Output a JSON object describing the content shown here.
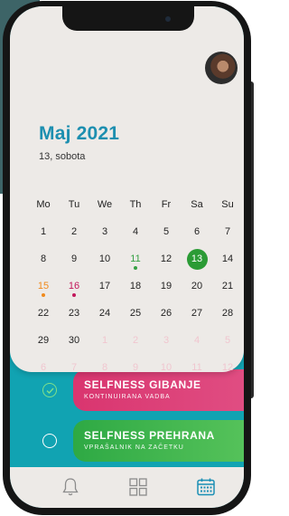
{
  "calendar": {
    "month_title": "Maj 2021",
    "date_subtitle": "13, sobota",
    "weekdays": [
      "Mo",
      "Tu",
      "We",
      "Th",
      "Fr",
      "Sa",
      "Su"
    ],
    "rows": [
      [
        {
          "d": "1"
        },
        {
          "d": "2"
        },
        {
          "d": "3"
        },
        {
          "d": "4"
        },
        {
          "d": "5"
        },
        {
          "d": "6"
        },
        {
          "d": "7"
        }
      ],
      [
        {
          "d": "8"
        },
        {
          "d": "9"
        },
        {
          "d": "10"
        },
        {
          "d": "11",
          "style": "green-txt",
          "dot": "green"
        },
        {
          "d": "12"
        },
        {
          "d": "13",
          "style": "selected"
        },
        {
          "d": "14"
        }
      ],
      [
        {
          "d": "15",
          "style": "orange-txt",
          "dot": "orange"
        },
        {
          "d": "16",
          "style": "pink-txt",
          "dot": "pink"
        },
        {
          "d": "17"
        },
        {
          "d": "18"
        },
        {
          "d": "19"
        },
        {
          "d": "20"
        },
        {
          "d": "21"
        }
      ],
      [
        {
          "d": "22"
        },
        {
          "d": "23"
        },
        {
          "d": "24"
        },
        {
          "d": "25"
        },
        {
          "d": "26"
        },
        {
          "d": "27"
        },
        {
          "d": "28"
        }
      ],
      [
        {
          "d": "29"
        },
        {
          "d": "30"
        },
        {
          "d": "1",
          "style": "muted"
        },
        {
          "d": "2",
          "style": "muted"
        },
        {
          "d": "3",
          "style": "muted"
        },
        {
          "d": "4",
          "style": "muted"
        },
        {
          "d": "5",
          "style": "muted"
        }
      ],
      [
        {
          "d": "6",
          "style": "muted"
        },
        {
          "d": "7",
          "style": "muted"
        },
        {
          "d": "8",
          "style": "muted"
        },
        {
          "d": "9",
          "style": "muted"
        },
        {
          "d": "10",
          "style": "muted"
        },
        {
          "d": "11",
          "style": "muted"
        },
        {
          "d": "12",
          "style": "muted"
        }
      ]
    ]
  },
  "tasks": [
    {
      "title": "SELFNESS GIBANJE",
      "subtitle": "KONTINUIRANA VADBA",
      "color": "#d9356f",
      "completed": true
    },
    {
      "title": "SELFNESS PREHRANA",
      "subtitle": "VPRAŠALNIK NA ZAČETKU",
      "color": "#2ea944",
      "completed": false
    }
  ],
  "nav": {
    "items": [
      {
        "icon": "bell-icon",
        "active": false
      },
      {
        "icon": "grid-icon",
        "active": false
      },
      {
        "icon": "calendar-icon",
        "active": true
      }
    ],
    "active_color": "#1b8fb5",
    "inactive_color": "#8b8b8b"
  },
  "colors": {
    "accent": "#1d8fb0",
    "selected_day": "#2b9b35",
    "screen_bg": "#11a3b2"
  }
}
